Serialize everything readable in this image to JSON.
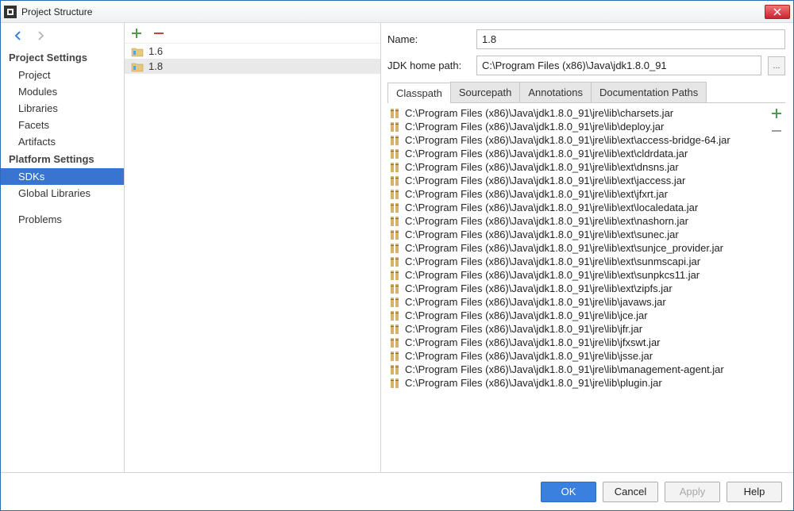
{
  "title": "Project Structure",
  "sidebar": {
    "section1": {
      "header": "Project Settings",
      "items": [
        "Project",
        "Modules",
        "Libraries",
        "Facets",
        "Artifacts"
      ]
    },
    "section2": {
      "header": "Platform Settings",
      "items": [
        "SDKs",
        "Global Libraries"
      ]
    },
    "section3": {
      "items": [
        "Problems"
      ]
    },
    "selected": "SDKs"
  },
  "sdks": {
    "items": [
      "1.6",
      "1.8"
    ],
    "selected": "1.8"
  },
  "form": {
    "name_label": "Name:",
    "name_value": "1.8",
    "path_label": "JDK home path:",
    "path_value": "C:\\Program Files (x86)\\Java\\jdk1.8.0_91",
    "browse_label": "..."
  },
  "tabs": {
    "items": [
      "Classpath",
      "Sourcepath",
      "Annotations",
      "Documentation Paths"
    ],
    "active": "Classpath"
  },
  "classpath": [
    "C:\\Program Files (x86)\\Java\\jdk1.8.0_91\\jre\\lib\\charsets.jar",
    "C:\\Program Files (x86)\\Java\\jdk1.8.0_91\\jre\\lib\\deploy.jar",
    "C:\\Program Files (x86)\\Java\\jdk1.8.0_91\\jre\\lib\\ext\\access-bridge-64.jar",
    "C:\\Program Files (x86)\\Java\\jdk1.8.0_91\\jre\\lib\\ext\\cldrdata.jar",
    "C:\\Program Files (x86)\\Java\\jdk1.8.0_91\\jre\\lib\\ext\\dnsns.jar",
    "C:\\Program Files (x86)\\Java\\jdk1.8.0_91\\jre\\lib\\ext\\jaccess.jar",
    "C:\\Program Files (x86)\\Java\\jdk1.8.0_91\\jre\\lib\\ext\\jfxrt.jar",
    "C:\\Program Files (x86)\\Java\\jdk1.8.0_91\\jre\\lib\\ext\\localedata.jar",
    "C:\\Program Files (x86)\\Java\\jdk1.8.0_91\\jre\\lib\\ext\\nashorn.jar",
    "C:\\Program Files (x86)\\Java\\jdk1.8.0_91\\jre\\lib\\ext\\sunec.jar",
    "C:\\Program Files (x86)\\Java\\jdk1.8.0_91\\jre\\lib\\ext\\sunjce_provider.jar",
    "C:\\Program Files (x86)\\Java\\jdk1.8.0_91\\jre\\lib\\ext\\sunmscapi.jar",
    "C:\\Program Files (x86)\\Java\\jdk1.8.0_91\\jre\\lib\\ext\\sunpkcs11.jar",
    "C:\\Program Files (x86)\\Java\\jdk1.8.0_91\\jre\\lib\\ext\\zipfs.jar",
    "C:\\Program Files (x86)\\Java\\jdk1.8.0_91\\jre\\lib\\javaws.jar",
    "C:\\Program Files (x86)\\Java\\jdk1.8.0_91\\jre\\lib\\jce.jar",
    "C:\\Program Files (x86)\\Java\\jdk1.8.0_91\\jre\\lib\\jfr.jar",
    "C:\\Program Files (x86)\\Java\\jdk1.8.0_91\\jre\\lib\\jfxswt.jar",
    "C:\\Program Files (x86)\\Java\\jdk1.8.0_91\\jre\\lib\\jsse.jar",
    "C:\\Program Files (x86)\\Java\\jdk1.8.0_91\\jre\\lib\\management-agent.jar",
    "C:\\Program Files (x86)\\Java\\jdk1.8.0_91\\jre\\lib\\plugin.jar"
  ],
  "footer": {
    "ok": "OK",
    "cancel": "Cancel",
    "apply": "Apply",
    "help": "Help"
  }
}
